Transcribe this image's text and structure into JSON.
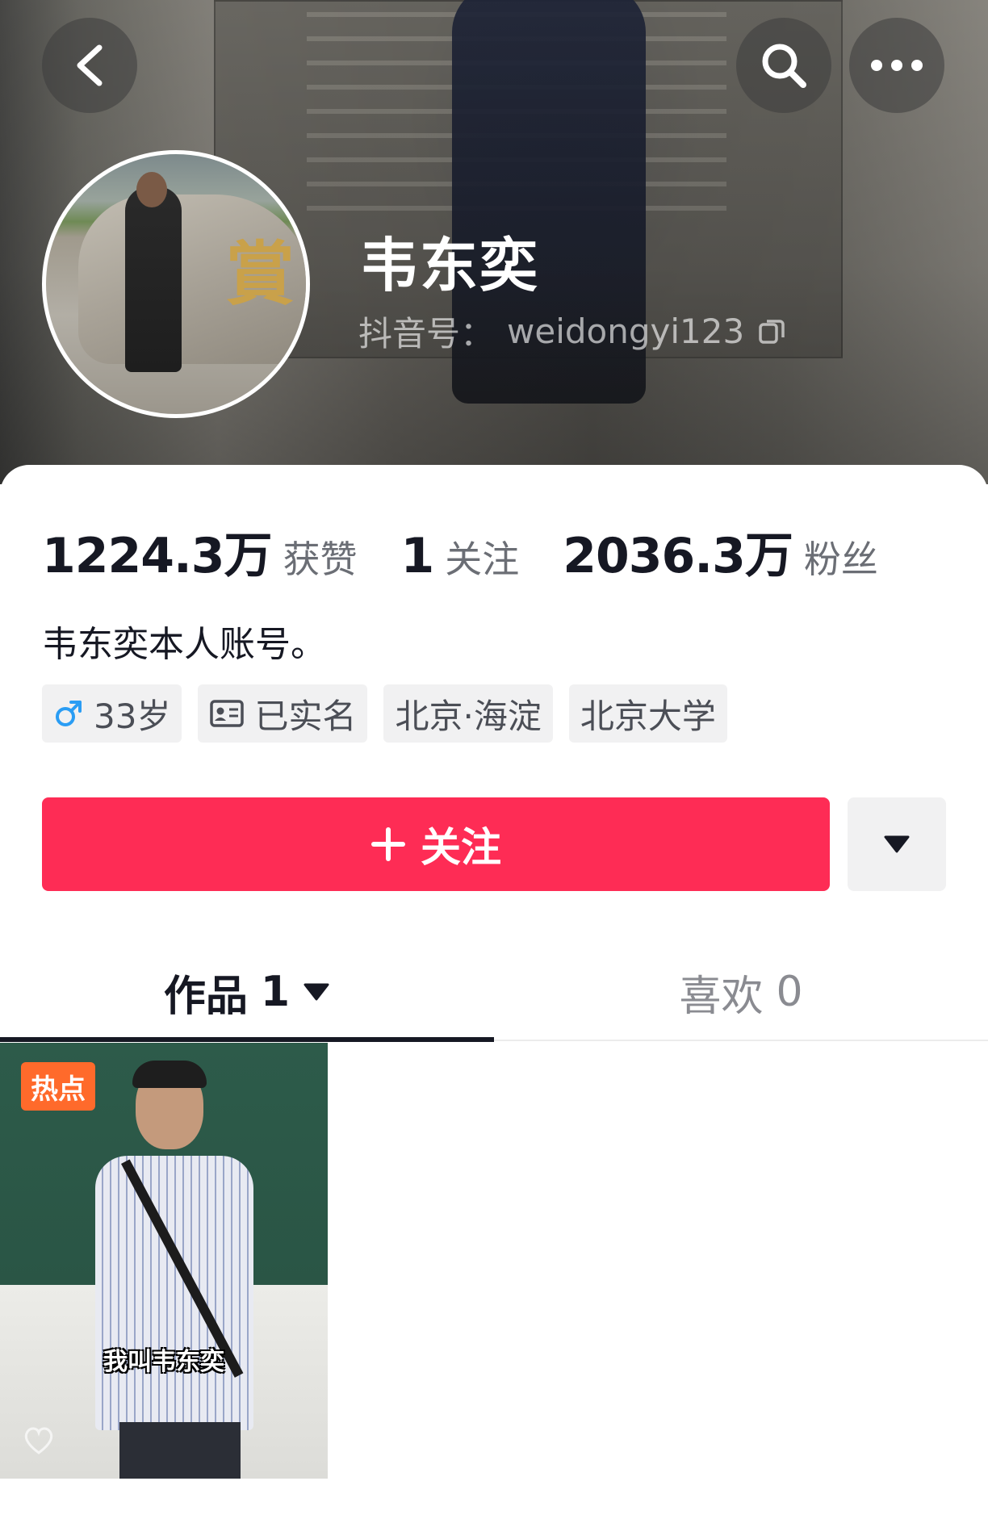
{
  "header": {
    "name": "韦东奕",
    "douyin_id_label": "抖音号：",
    "douyin_id": "weidongyi123"
  },
  "icons": {
    "back": "chevron-left-icon",
    "search": "search-icon",
    "more": "more-horizontal-icon",
    "copy": "copy-icon",
    "male": "male-icon",
    "id_card": "id-card-icon",
    "plus": "plus-icon",
    "triangle_down": "triangle-down-icon"
  },
  "stats": [
    {
      "value": "1224.3万",
      "label": "获赞"
    },
    {
      "value": "1",
      "label": "关注"
    },
    {
      "value": "2036.3万",
      "label": "粉丝"
    }
  ],
  "bio": "韦东奕本人账号。",
  "tags": [
    {
      "text": "33岁",
      "icon": "male-icon"
    },
    {
      "text": "已实名",
      "icon": "id-card-icon"
    },
    {
      "text": "北京·海淀",
      "icon": ""
    },
    {
      "text": "北京大学",
      "icon": ""
    }
  ],
  "actions": {
    "follow_label": "关注"
  },
  "tabs": [
    {
      "label": "作品",
      "count": "1",
      "active": true
    },
    {
      "label": "喜欢",
      "count": "0",
      "active": false
    }
  ],
  "videos": [
    {
      "badge": "热点",
      "caption": "我叫韦东奕"
    }
  ],
  "colors": {
    "accent": "#fe2c55",
    "hot_badge": "#ff6a2b",
    "male_icon": "#2a9df4"
  }
}
